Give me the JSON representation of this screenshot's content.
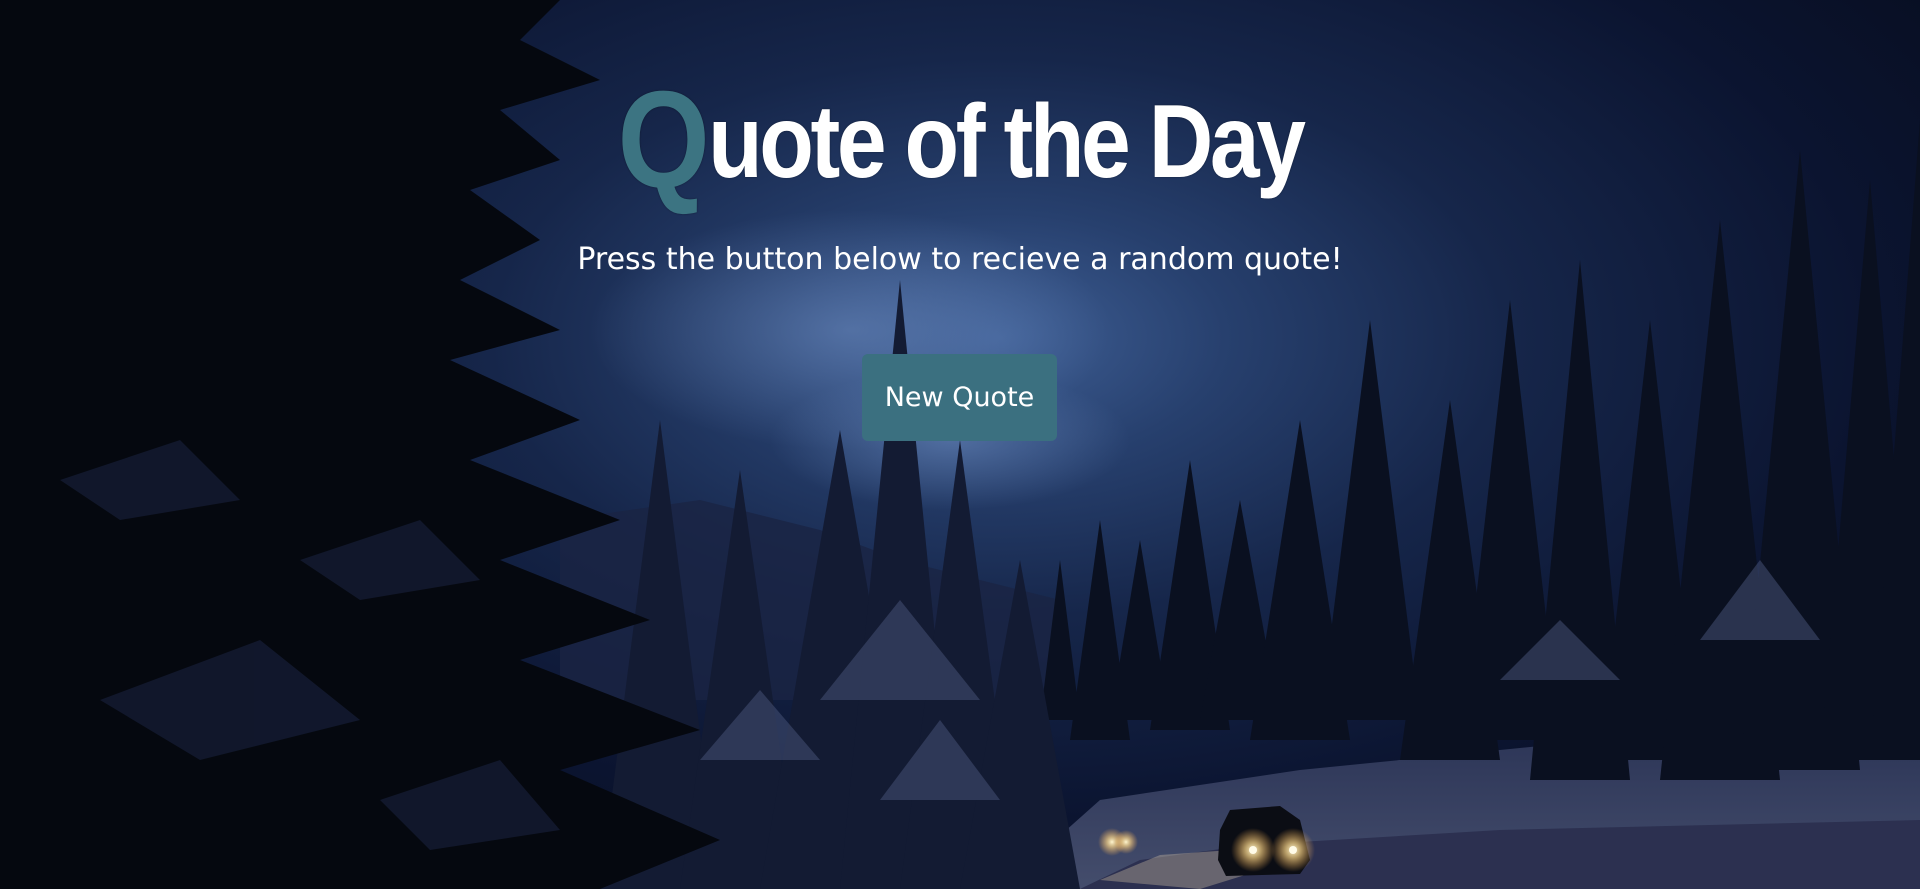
{
  "header": {
    "title_first_letter": "Q",
    "title_rest": "uote of the Day",
    "subtitle": "Press the button below to recieve a random quote!"
  },
  "controls": {
    "new_quote_label": "New Quote"
  },
  "colors": {
    "accent": "#3c7482",
    "button_bg": "#3b7080",
    "text": "#ffffff",
    "sky_dark": "#0b1430"
  },
  "background": {
    "icon": "night-forest-road-photo"
  }
}
